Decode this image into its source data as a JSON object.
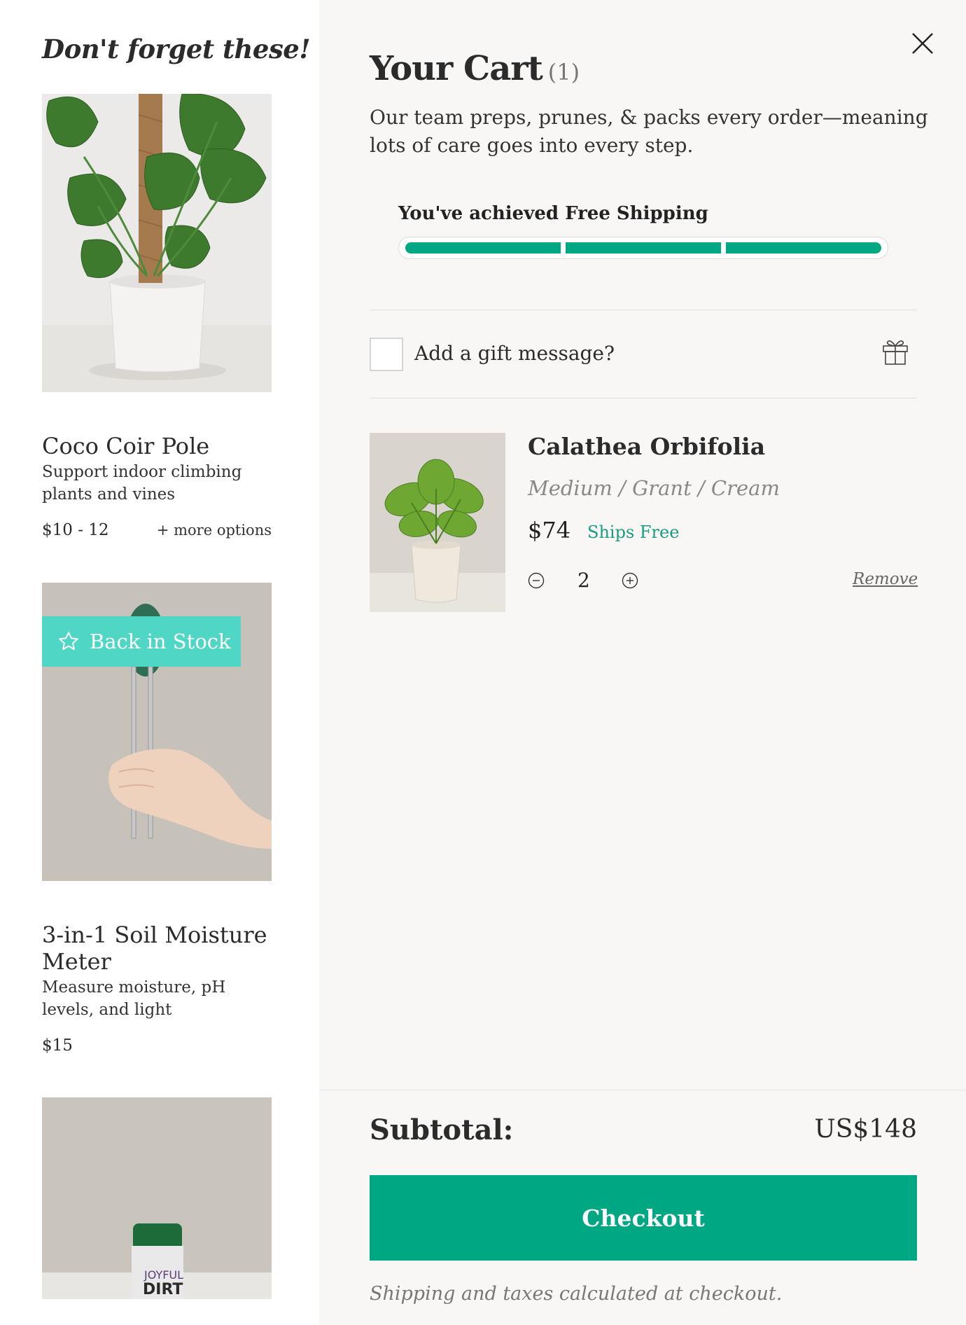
{
  "upsell": {
    "title": "Don't forget these!",
    "products": [
      {
        "name": "Coco Coir Pole",
        "description": "Support indoor climbing plants and vines",
        "price": "$10 - 12",
        "more_options": "+ more options"
      },
      {
        "name": "3-in-1 Soil Moisture Meter",
        "description": "Measure moisture, pH levels, and light",
        "price": "$15",
        "badge": "Back in Stock"
      },
      {
        "image_label_top": "JOYFUL",
        "image_label_bottom": "DIRT"
      }
    ]
  },
  "cart": {
    "title": "Your Cart",
    "count": "(1)",
    "intro": "Our team preps, prunes, & packs every order—meaning lots of care goes into every step.",
    "shipping": {
      "label": "You've achieved Free Shipping",
      "progress_fraction": 1.0
    },
    "gift": {
      "label": "Add a gift message?",
      "checked": false
    },
    "items": [
      {
        "name": "Calathea Orbifolia",
        "variant": "Medium / Grant / Cream",
        "price": "$74",
        "shipping_note": "Ships Free",
        "quantity": "2",
        "remove_label": "Remove"
      }
    ],
    "subtotal_label": "Subtotal:",
    "subtotal_value": "US$148",
    "checkout_label": "Checkout",
    "note": "Shipping and taxes calculated at checkout."
  },
  "colors": {
    "accent": "#00a783",
    "badge": "#4fd6c4",
    "panel_bg": "#f8f7f5"
  }
}
